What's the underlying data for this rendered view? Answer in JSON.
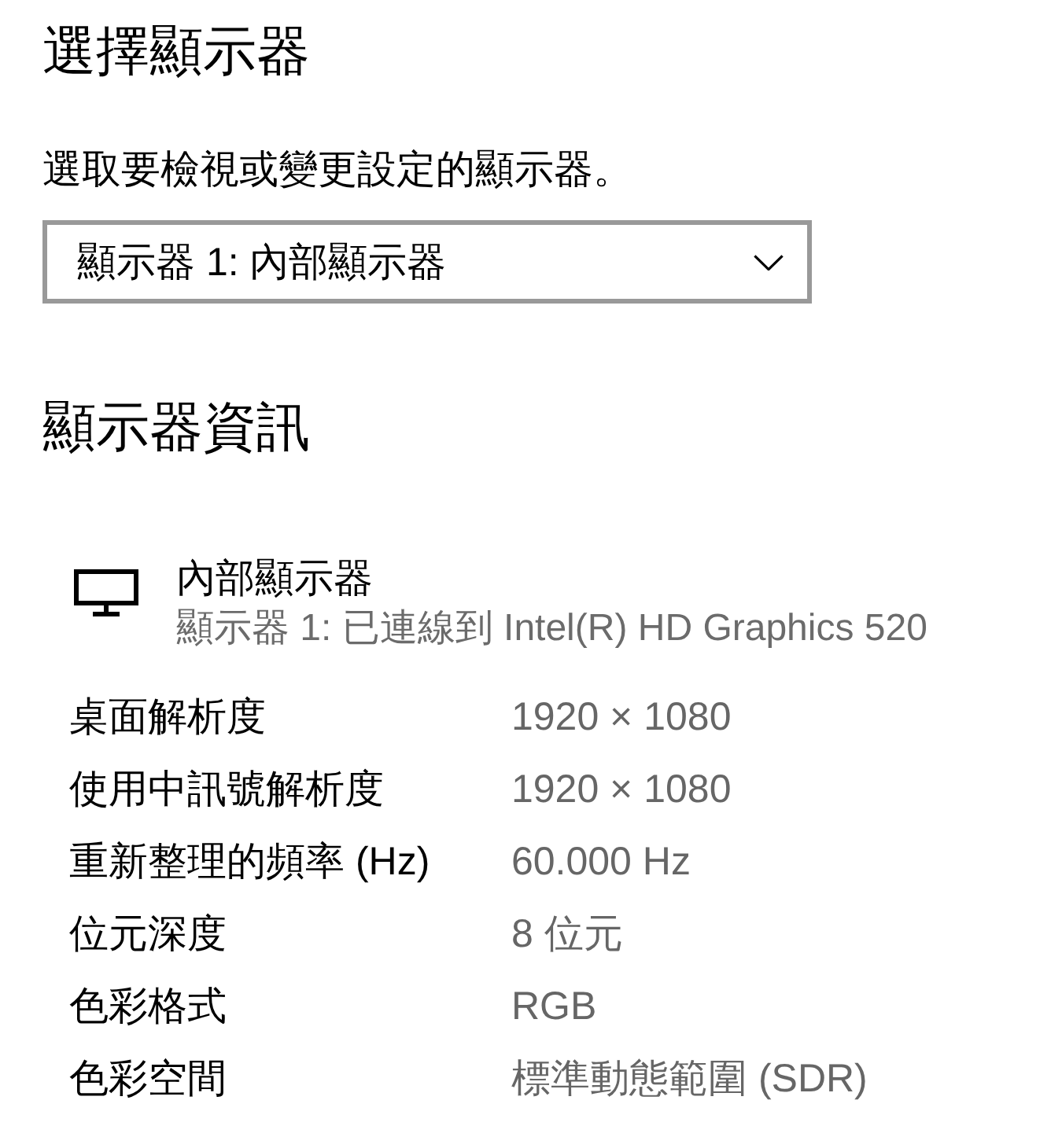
{
  "page_title": "選擇顯示器",
  "select_display": {
    "description": "選取要檢視或變更設定的顯示器。",
    "dropdown": {
      "value": "顯示器 1: 內部顯示器",
      "expanded": false
    }
  },
  "display_info": {
    "heading": "顯示器資訊",
    "display": {
      "name": "內部顯示器",
      "connection": "顯示器 1: 已連線到 Intel(R) HD Graphics 520"
    },
    "rows": [
      {
        "label": "桌面解析度",
        "value": "1920 × 1080"
      },
      {
        "label": "使用中訊號解析度",
        "value": "1920 × 1080"
      },
      {
        "label": "重新整理的頻率 (Hz)",
        "value": "60.000 Hz"
      },
      {
        "label": "位元深度",
        "value": "8 位元"
      },
      {
        "label": "色彩格式",
        "value": "RGB"
      },
      {
        "label": "色彩空間",
        "value": "標準動態範圍 (SDR)"
      }
    ]
  }
}
